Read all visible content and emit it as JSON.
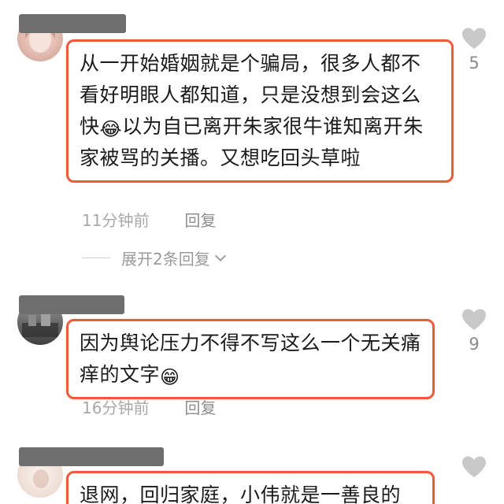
{
  "accent_color": "#f05a3c",
  "comments": [
    {
      "text_parts": [
        "从一开始婚姻就是个骗局，很多人都不看好明眼人都知道，只是没想到会这么快",
        "以为自已离开朱家很牛谁知离开朱家被骂的关播。又想吃回头草啦"
      ],
      "emoji": "😂",
      "likes": "5",
      "time": "11分钟前",
      "reply_label": "回复",
      "expand_label": "展开2条回复",
      "heart_icon": "heart-icon"
    },
    {
      "text_parts": [
        "因为舆论压力不得不写这么一个无关痛痒的文字",
        ""
      ],
      "emoji": "😁",
      "likes": "9",
      "time": "16分钟前",
      "reply_label": "回复",
      "heart_icon": "heart-icon"
    },
    {
      "text_parts": [
        "退网，回归家庭，小伟就是一善良的",
        ""
      ],
      "likes": "",
      "heart_icon": "heart-icon"
    }
  ]
}
